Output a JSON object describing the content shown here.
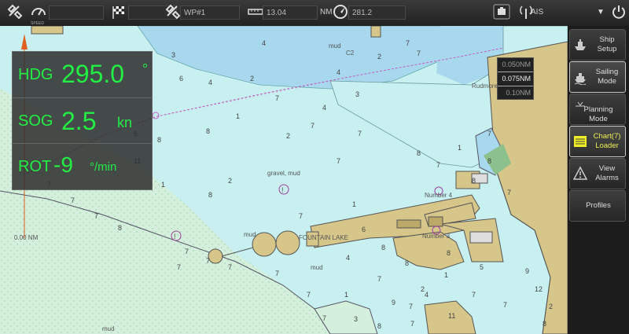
{
  "topbar": {
    "speed_label": "SPEED",
    "waypoint": "WP#1",
    "distance": "13.04",
    "distance_unit": "NM",
    "bearing": "281.2",
    "ais_label": "AIS"
  },
  "hud": {
    "hdg_label": "HDG",
    "hdg_value": "295.0",
    "hdg_unit": "°",
    "sog_label": "SOG",
    "sog_value": "2.5",
    "sog_unit": "kn",
    "rot_label": "ROT",
    "rot_value": "-9",
    "rot_unit": "°/min"
  },
  "scale": {
    "items": [
      "0.050NM",
      "0.075NM",
      "0.10NM"
    ],
    "selected": "0.075NM"
  },
  "range_label": "0.00 NM",
  "map_labels": {
    "rudmore": "Rudmore Channel",
    "fountain": "FOUNTAIN LAKE",
    "number4": "Number 4",
    "number3": "Number 3",
    "gravel_mud": "gravel, mud",
    "mud1": "mud",
    "mud2": "mud",
    "mud3": "mud",
    "mud4": "mud",
    "c2": "C2",
    "soundings": [
      "4",
      "3",
      "4",
      "6",
      "2",
      "4",
      "7",
      "2",
      "7",
      "3",
      "4",
      "1",
      "8",
      "2",
      "8",
      "8",
      "7",
      "1",
      "7",
      "2",
      "8",
      "1",
      "7",
      "1",
      "6",
      "8",
      "4",
      "8",
      "8",
      "1",
      "5",
      "9",
      "2",
      "9",
      "1",
      "11",
      "7",
      "12",
      "2",
      "8",
      "7",
      "8",
      "3",
      "7",
      "7",
      "7",
      "7",
      "7",
      "7",
      "7",
      "8",
      "7",
      "7",
      "7",
      "7",
      "7",
      "4",
      "7",
      "7",
      "11",
      "6",
      "7",
      "7",
      "7",
      "8",
      "8",
      "7"
    ]
  },
  "sidebar": {
    "ship_setup": [
      "Ship",
      "Setup"
    ],
    "sailing_mode": [
      "Sailing",
      "Mode"
    ],
    "planning_mode": [
      "Planning",
      "Mode"
    ],
    "chart_loader": [
      "Chart(7)",
      "Loader"
    ],
    "view_alarms": [
      "View",
      "Alarms"
    ],
    "profiles": "Profiles"
  }
}
